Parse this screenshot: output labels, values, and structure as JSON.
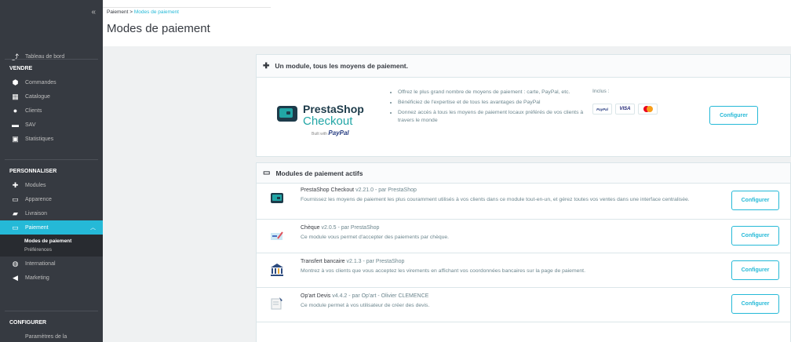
{
  "sidebar": {
    "collapse_label": "«",
    "dashboard": "Tableau de bord",
    "sections": {
      "vendre": "VENDRE",
      "personnaliser": "PERSONNALISER",
      "configurer": "CONFIGURER"
    },
    "vendre_items": [
      "Commandes",
      "Catalogue",
      "Clients",
      "SAV",
      "Statistiques"
    ],
    "perso_items": [
      "Modules",
      "Apparence",
      "Livraison"
    ],
    "active_item": "Paiement",
    "sub_items": [
      "Modes de paiement",
      "Préférences"
    ],
    "other_items": [
      "International",
      "Marketing"
    ],
    "config_items": [
      "Paramètres de la"
    ]
  },
  "header": {
    "breadcrumb_root": "Paiement",
    "breadcrumb_sep": ">",
    "breadcrumb_current": "Modes de paiement",
    "title": "Modes de paiement"
  },
  "checkout_card": {
    "title": "Un module, tous les moyens de paiement.",
    "logo_line1": "PrestaShop",
    "logo_line2": "Checkout",
    "logo_sub": "Built with",
    "logo_paypal": "PayPal",
    "features": [
      "Offrez le plus grand nombre de moyens de paiement : carte, PayPal, etc.",
      "Bénéficiez de l'expertise et de tous les avantages de PayPal",
      "Donnez accès à tous les moyens de paiement locaux préférés de vos clients à travers le monde"
    ],
    "inclus_label": "Inclus :",
    "pay_logos": [
      "PayPal",
      "VISA"
    ],
    "configure_label": "Configurer"
  },
  "active_card": {
    "title": "Modules de paiement actifs",
    "modules": [
      {
        "name": "PrestaShop Checkout",
        "version": "v2.21.0 - par PrestaShop",
        "description": "Fournissez les moyens de paiement les plus couramment utilisés à vos clients dans ce module tout-en-un, et gérez toutes vos ventes dans une interface centralisée.",
        "button": "Configurer"
      },
      {
        "name": "Chèque",
        "version": "v2.0.5 - par PrestaShop",
        "description": "Ce module vous permet d'accepter des paiements par chèque.",
        "button": "Configurer"
      },
      {
        "name": "Transfert bancaire",
        "version": "v2.1.3 - par PrestaShop",
        "description": "Montrez à vos clients que vous acceptez les virements en affichant vos coordonnées bancaires sur la page de paiement.",
        "button": "Configurer"
      },
      {
        "name": "Op'art Devis",
        "version": "v4.4.2 - par Op'art - Olivier CLEMENCE",
        "description": "Ce module permet à vos utilisateur de créer des devis.",
        "button": "Configurer"
      }
    ]
  },
  "colors": {
    "sidebar_bg": "#363a41",
    "accent": "#25b9d7",
    "page_bg": "#eff1f2"
  }
}
